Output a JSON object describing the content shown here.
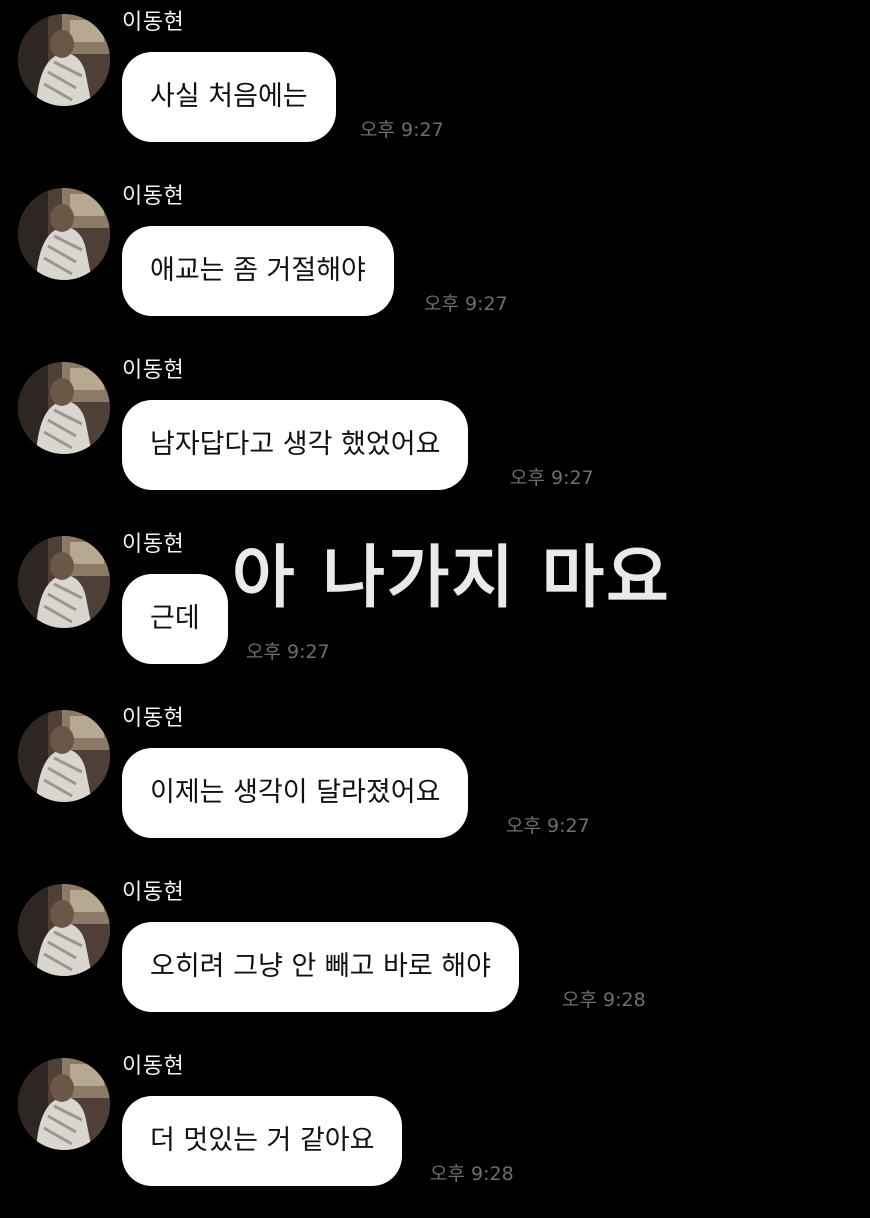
{
  "chat": {
    "messages": [
      {
        "sender": "이동현",
        "text": "사실 처음에는",
        "time": "오후 9:27"
      },
      {
        "sender": "이동현",
        "text": "애교는 좀 거절해야",
        "time": "오후 9:27"
      },
      {
        "sender": "이동현",
        "text": "남자답다고 생각 했었어요",
        "time": "오후 9:27"
      },
      {
        "sender": "이동현",
        "text": "근데",
        "time": "오후 9:27"
      },
      {
        "sender": "이동현",
        "text": "이제는 생각이 달라졌어요",
        "time": "오후 9:27"
      },
      {
        "sender": "이동현",
        "text": "오히려 그냥 안 빼고 바로 해야",
        "time": "오후 9:28"
      },
      {
        "sender": "이동현",
        "text": "더 멋있는 거 같아요",
        "time": "오후 9:28"
      }
    ]
  },
  "overlay_caption": "아 나가지 마요",
  "colors": {
    "background": "#000000",
    "bubble": "#ffffff",
    "bubble_text": "#111111",
    "sender_text": "#f2f2f2",
    "timestamp": "#6e6e6e",
    "caption": "#eaeaea"
  },
  "icons": {
    "avatar": "profile-photo"
  }
}
